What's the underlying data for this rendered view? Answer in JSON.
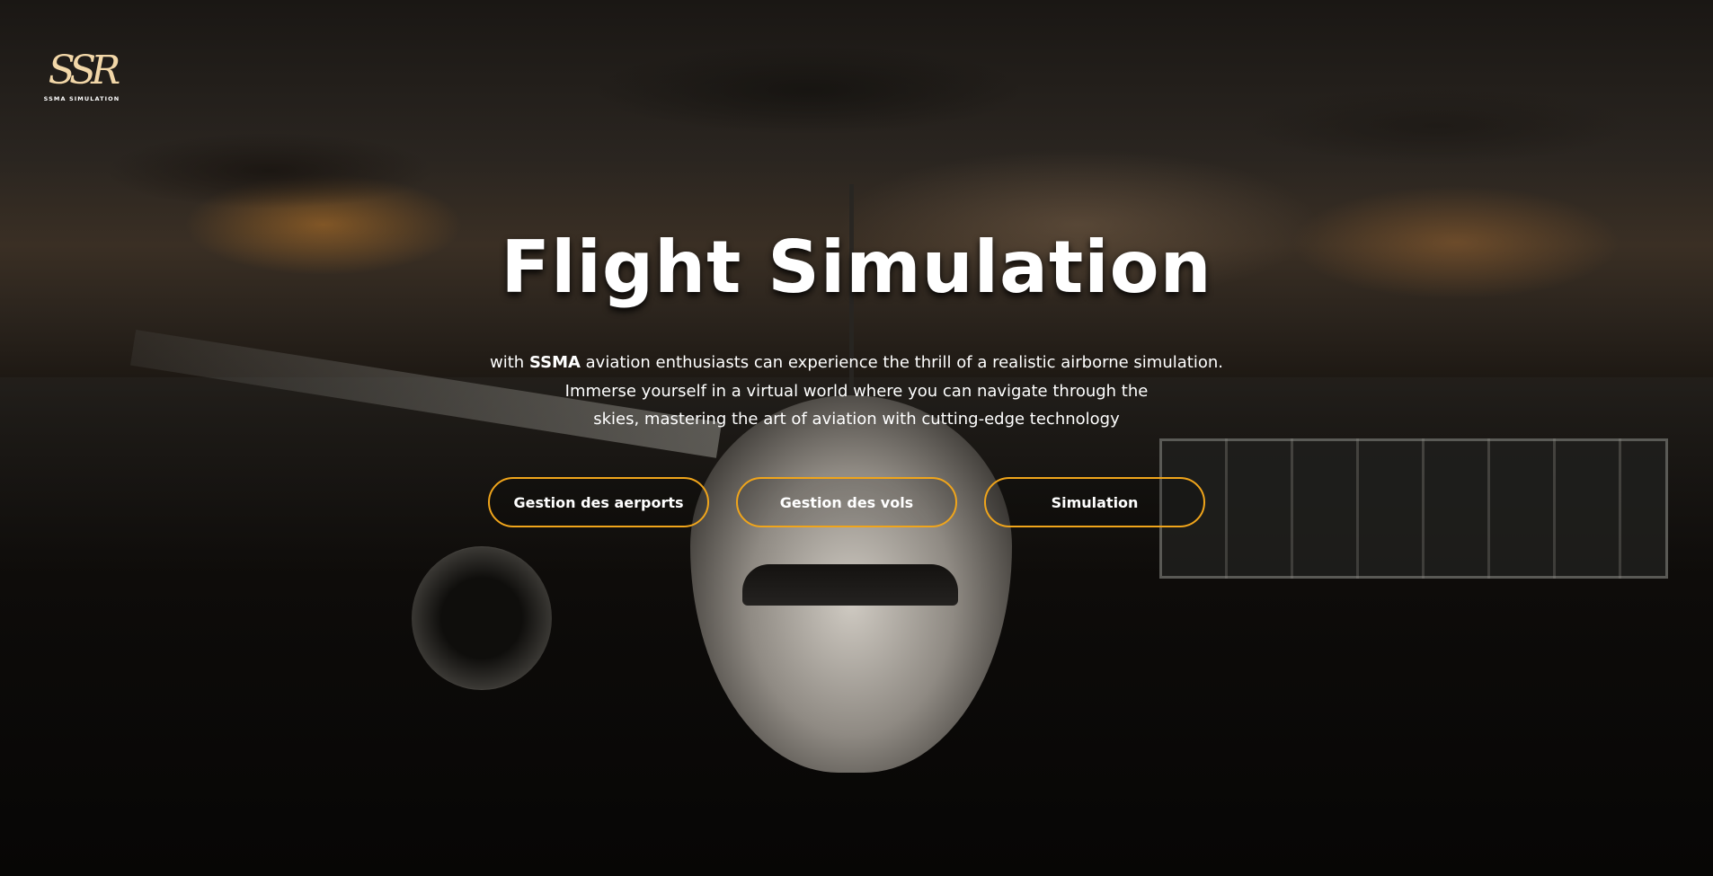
{
  "brand": {
    "logo_mark": "SSR",
    "logo_text": "SSMA SIMULATION"
  },
  "hero": {
    "title": "Flight Simulation",
    "subtitle": {
      "lead": "with",
      "brand": "SSMA",
      "line1_rest": " aviation enthusiasts can experience the thrill of a realistic airborne simulation.",
      "line2": "Immerse yourself in a virtual world where you can navigate through the",
      "line3": "skies, mastering the art of aviation with cutting-edge technology"
    }
  },
  "actions": [
    {
      "label": "Gestion des aerports"
    },
    {
      "label": "Gestion des vols"
    },
    {
      "label": "Simulation"
    }
  ],
  "colors": {
    "accent": "#f0a51b",
    "text": "#ffffff"
  }
}
